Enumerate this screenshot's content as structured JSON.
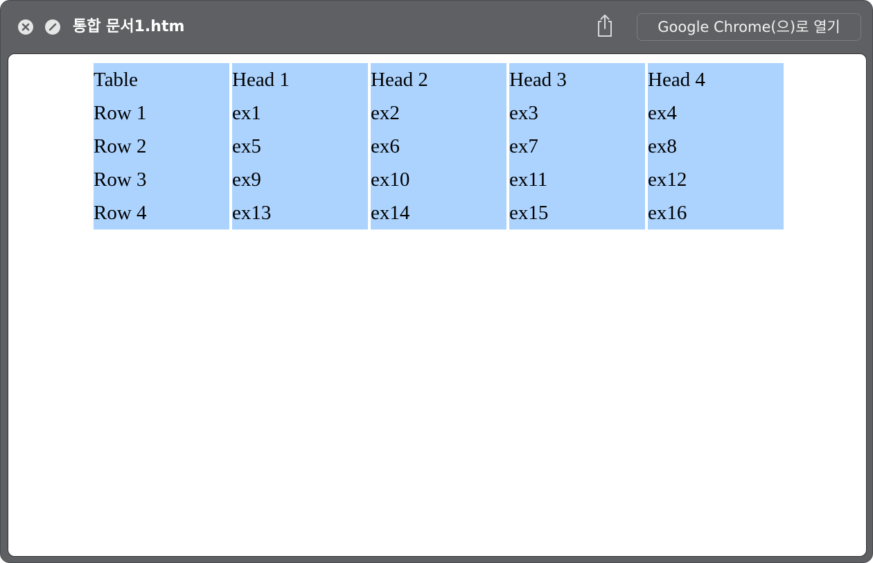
{
  "window": {
    "title": "통합 문서1.htm",
    "open_button_label": "Google Chrome(으)로 열기"
  },
  "icons": {
    "close": "close-icon",
    "block": "block-icon",
    "share": "share-icon"
  },
  "colors": {
    "titlebar": "#5f6063",
    "cell_background": "#acd3fe",
    "page_background": "#ffffff"
  },
  "table": {
    "header": [
      "Table",
      "Head 1",
      "Head 2",
      "Head 3",
      "Head 4"
    ],
    "rows": [
      [
        "Row 1",
        "ex1",
        "ex2",
        "ex3",
        "ex4"
      ],
      [
        "Row 2",
        "ex5",
        "ex6",
        "ex7",
        "ex8"
      ],
      [
        "Row 3",
        "ex9",
        "ex10",
        "ex11",
        "ex12"
      ],
      [
        "Row 4",
        "ex13",
        "ex14",
        "ex15",
        "ex16"
      ]
    ]
  }
}
